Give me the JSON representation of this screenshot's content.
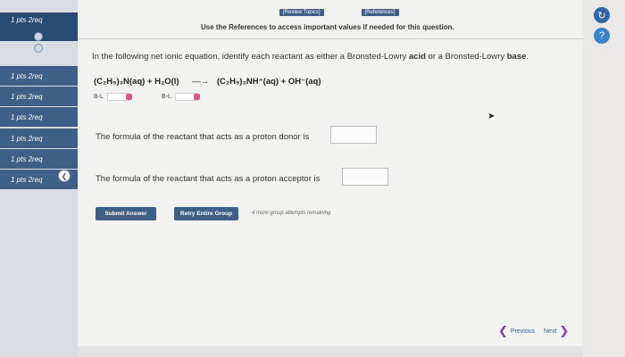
{
  "sidebar": {
    "items": [
      {
        "label": "1 pts   2req"
      },
      {
        "label": "1 pts   2req"
      },
      {
        "label": "1 pts   2req"
      },
      {
        "label": "1 pts   2req"
      },
      {
        "label": "1 pts   2req"
      },
      {
        "label": "1 pts   2req"
      },
      {
        "label": "1 pts   2req"
      }
    ]
  },
  "header": {
    "review_topics": "[Review Topics]",
    "references": "[References]",
    "references_note": "Use the References to access important values if needed for this question."
  },
  "question": {
    "text_before": "In the following net ionic equation, identify each reactant as either a Bronsted-Lowry ",
    "acid": "acid",
    "text_middle": " or a Bronsted-Lowry ",
    "base": "base",
    "text_after": "."
  },
  "equation": {
    "left": "(C₂H₅)₃N(aq) + H₂O(l)",
    "arrow": "—→",
    "right": "(C₂H₅)₃NH⁺(aq) + OH⁻(aq)"
  },
  "bl_labels": {
    "first": "B-L",
    "second": "B-L"
  },
  "prompts": {
    "donor": "The formula of the reactant that acts as a proton donor is",
    "acceptor": "The formula of the reactant that acts as a proton acceptor is"
  },
  "buttons": {
    "submit": "Submit Answer",
    "retry": "Retry Entire Group",
    "attempts": "4 more group attempts remaining"
  },
  "nav": {
    "previous": "Previous",
    "next": "Next"
  },
  "icons": {
    "help": "help-icon",
    "settings": "settings-icon",
    "collapse": "chevron-left-icon"
  },
  "colors": {
    "accent": "#3f5f86",
    "badge": "#e7508f",
    "nav_chevron": "#7a3fa0"
  }
}
